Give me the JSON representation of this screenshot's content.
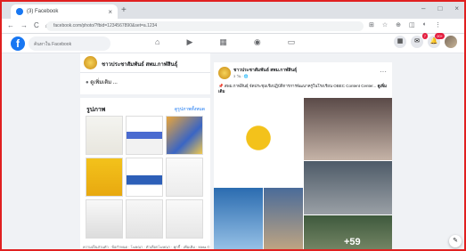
{
  "browser": {
    "tab_title": "(3) Facebook",
    "tab_close": "×",
    "new_tab": "+",
    "window_controls": [
      "–",
      "□",
      "×"
    ],
    "nav": [
      "←",
      "→",
      "C",
      "⌂"
    ],
    "url": "facebook.com/photo/?fbid=1234567890&set=a.1234",
    "extensions": [
      "⊞",
      "☆",
      "⊕",
      "◫",
      "◐",
      "⋮"
    ]
  },
  "fb": {
    "logo": "f",
    "search_placeholder": "ค้นหาใน Facebook",
    "nav_icons": [
      "home-icon",
      "video-icon",
      "marketplace-icon",
      "groups-icon",
      "gaming-icon"
    ],
    "nav_glyphs": [
      "⌂",
      "▶",
      "▦",
      "◉",
      "▭"
    ],
    "right_icons": [
      "▦",
      "✉",
      "🔔"
    ],
    "messenger_badge": "7",
    "notif_badge": "20+"
  },
  "page": {
    "name": "ชาวประชาสัมพันธ์ สพม.กาฬสินธุ์",
    "see_more": "ดูเพิ่มเติม",
    "photos_title": "รูปภาพ",
    "photos_see_all": "ดูรูปภาพทั้งหมด",
    "footer": "ความเป็นส่วนตัว · ข้อกำหนด · โฆษณา · ตัวเลือกโฆษณา · คุกกี้ · เพิ่มเติม · Meta © 2024"
  },
  "post": {
    "author": "ชาวประชาสัมพันธ์ สพม.กาฬสินธุ์",
    "meta": "3 วัน · 🌐",
    "more": "···",
    "text": "📌 สพม.กาฬสินธุ์ จัดประชุมเชิงปฏิบัติการการพัฒนาครูในโรงเรียน OBEC Content Center...",
    "see_more": "ดูเพิ่มเติม",
    "extra_photos": "+59"
  },
  "edit_icon": "✎"
}
